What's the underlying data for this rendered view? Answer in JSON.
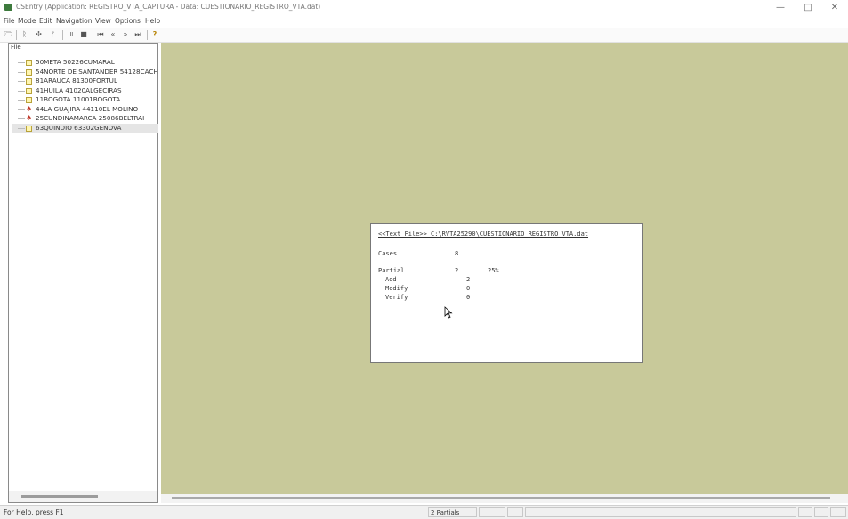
{
  "window": {
    "title": "CSEntry (Application: REGISTRO_VTA_CAPTURA - Data: CUESTIONARIO_REGISTRO_VTA.dat)",
    "minimize_icon": "minimize-icon",
    "maximize_icon": "maximize-icon",
    "close_icon": "close-icon",
    "minimize_glyph": "—",
    "maximize_glyph": "□",
    "close_glyph": "✕"
  },
  "menu": [
    "File",
    "Mode",
    "Edit",
    "Navigation",
    "View",
    "Options",
    "Help"
  ],
  "toolbar": {
    "buttons": [
      {
        "name": "open-icon",
        "glyph": "🗁"
      },
      {
        "name": "add-case-icon",
        "glyph": "ᚱ"
      },
      {
        "name": "modify-case-icon",
        "glyph": "✣"
      },
      {
        "name": "verify-case-icon",
        "glyph": "ᚠ"
      },
      {
        "name": "pause-icon",
        "glyph": "॥"
      },
      {
        "name": "stop-icon",
        "glyph": "■"
      },
      {
        "name": "first-icon",
        "glyph": "⏮"
      },
      {
        "name": "previous-icon",
        "glyph": "«"
      },
      {
        "name": "next-icon",
        "glyph": "»"
      },
      {
        "name": "last-icon",
        "glyph": "⏭"
      },
      {
        "name": "help-icon",
        "glyph": "?"
      }
    ]
  },
  "tree": {
    "header": "File",
    "items": [
      {
        "label": "50META        50226CUMARAL",
        "status": "complete"
      },
      {
        "label": "54NORTE DE SANTANDER  54128CACH",
        "status": "complete"
      },
      {
        "label": "81ARAUCA        81300FORTUL",
        "status": "complete"
      },
      {
        "label": "41HUILA        41020ALGECIRAS",
        "status": "complete"
      },
      {
        "label": "11BOGOTA         11001BOGOTA",
        "status": "complete"
      },
      {
        "label": "44LA GUAJIRA      44110EL MOLINO",
        "status": "partial"
      },
      {
        "label": "25CUNDINAMARCA     25086BELTRAI",
        "status": "partial"
      },
      {
        "label": "63QUINDIO        63302GENOVA",
        "status": "complete",
        "selected": true
      }
    ]
  },
  "document": {
    "header": "<<Text File>> C:\\RVTA25290\\CUESTIONARIO_REGISTRO_VTA.dat",
    "cases_label": "Cases",
    "cases_value": "8",
    "partial_label": "Partial",
    "partial_value": "2",
    "partial_pct": "25%",
    "add_label": "Add",
    "add_value": "2",
    "modify_label": "Modify",
    "modify_value": "0",
    "verify_label": "Verify",
    "verify_value": "0"
  },
  "status": {
    "help_text": "For Help, press F1",
    "partials": "2 Partials"
  }
}
